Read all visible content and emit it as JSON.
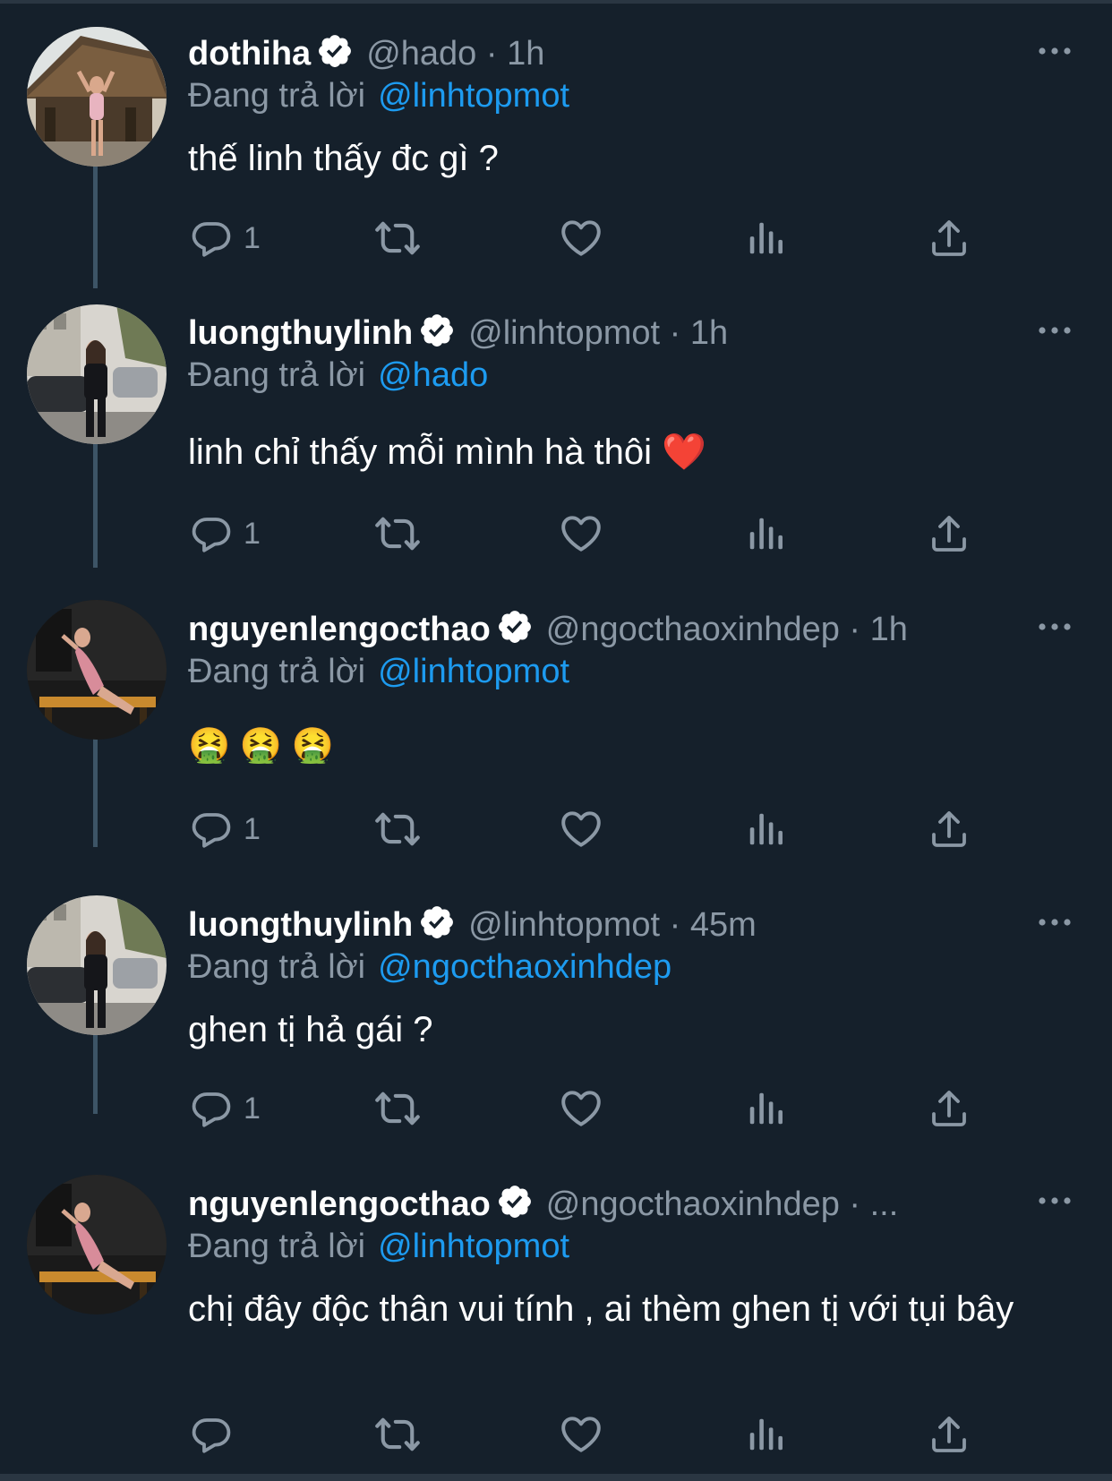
{
  "theme": {
    "background": "#15202b",
    "text": "#ffffff",
    "muted": "#8b98a5",
    "accent": "#1d9bf0",
    "thread_line": "#3d5466"
  },
  "reply_prefix": "Đang trả lời",
  "tweets": [
    {
      "username": "dothiha",
      "handle_time": "@hado · 1h",
      "reply_to": "@linhtopmot",
      "text": "thế linh thấy đc gì ?",
      "reply_count": "1",
      "avatar_icon": "woman-near-thatched-hut-avatar"
    },
    {
      "username": "luongthuylinh",
      "handle_time": "@linhtopmot · 1h",
      "reply_to": "@hado",
      "text": "linh chỉ thấy mỗi mình hà thôi ❤️",
      "reply_count": "1",
      "avatar_icon": "woman-street-cars-avatar"
    },
    {
      "username": "nguyenlengocthao",
      "handle_time": "@ngocthaoxinhdep · 1h",
      "reply_to": "@linhtopmot",
      "text": "🤮 🤮 🤮",
      "reply_count": "1",
      "avatar_icon": "woman-pink-dress-bench-avatar"
    },
    {
      "username": "luongthuylinh",
      "handle_time": "@linhtopmot · 45m",
      "reply_to": "@ngocthaoxinhdep",
      "text": "ghen tị hả gái ?",
      "reply_count": "1",
      "avatar_icon": "woman-street-cars-avatar"
    },
    {
      "username": "nguyenlengocthao",
      "handle_time": "@ngocthaoxinhdep · ...",
      "reply_to": "@linhtopmot",
      "text": "chị đây độc thân vui tính , ai thèm ghen tị với tụi bây",
      "reply_count": "",
      "avatar_icon": "woman-pink-dress-bench-avatar"
    }
  ],
  "icons": {
    "reply": "reply-bubble-icon",
    "retweet": "retweet-icon",
    "like": "heart-icon",
    "views": "analytics-bars-icon",
    "share": "share-upload-icon",
    "more": "more-dots-icon",
    "verified": "verified-badge-icon"
  }
}
